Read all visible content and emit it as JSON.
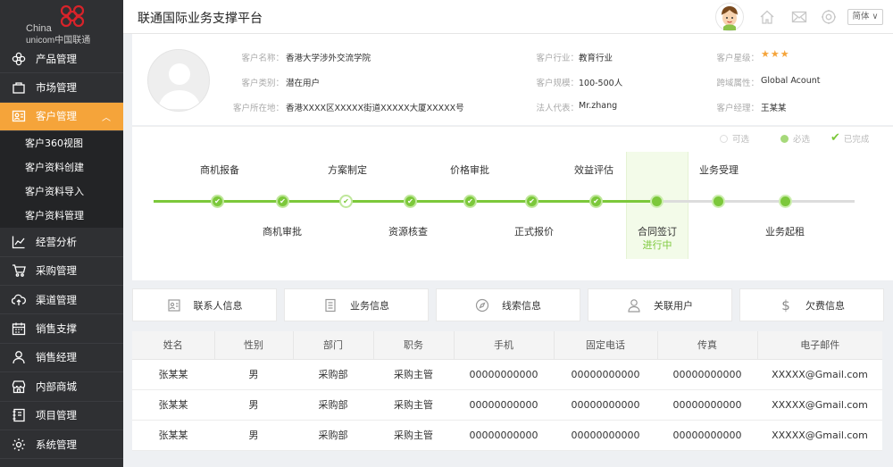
{
  "app": {
    "logo_china": "China",
    "logo_unicom": "unicom中国联通",
    "title": "联通国际业务支撑平台",
    "lang": "简体 ∨"
  },
  "sidebar": {
    "items": [
      {
        "label": "产品管理",
        "icon": "product-icon"
      },
      {
        "label": "市场管理",
        "icon": "market-icon"
      },
      {
        "label": "客户管理",
        "icon": "customer-icon",
        "active": true
      },
      {
        "label": "经营分析",
        "icon": "chart-icon"
      },
      {
        "label": "采购管理",
        "icon": "cart-icon"
      },
      {
        "label": "渠道管理",
        "icon": "cloud-icon"
      },
      {
        "label": "销售支撑",
        "icon": "calendar-icon"
      },
      {
        "label": "销售经理",
        "icon": "user-icon"
      },
      {
        "label": "内部商城",
        "icon": "shop-icon"
      },
      {
        "label": "项目管理",
        "icon": "book-icon"
      },
      {
        "label": "系统管理",
        "icon": "gear-icon"
      }
    ],
    "submenu": [
      "客户360视图",
      "客户资料创建",
      "客户资料导入",
      "客户资料管理"
    ]
  },
  "customer": {
    "name_label": "客户名称：",
    "name": "香港大学涉外交流学院",
    "type_label": "客户类别：",
    "type": "潜在用户",
    "location_label": "客户所在地：",
    "location": "香港XXXX区XXXXX街道XXXXX大厦XXXXX号",
    "industry_label": "客户行业：",
    "industry": "教育行业",
    "scale_label": "客户规模：",
    "scale": "100-500人",
    "legal_label": "法人代表：",
    "legal": "Mr.zhang",
    "rating_label": "客户星级：",
    "rating": 3,
    "cross_label": "跨域属性：",
    "cross": "Global Acount",
    "manager_label": "客户经理：",
    "manager": "王某某"
  },
  "legend": {
    "optional": "可选",
    "required": "必选",
    "done": "已完成"
  },
  "stages": {
    "top": [
      "商机报备",
      "方案制定",
      "价格审批",
      "效益评估",
      "业务受理"
    ],
    "bottom": [
      "商机审批",
      "资源核查",
      "正式报价",
      "合同签订",
      "业务起租"
    ],
    "current_status": "进行中"
  },
  "tabs": [
    "联系人信息",
    "业务信息",
    "线索信息",
    "关联用户",
    "欠费信息"
  ],
  "table": {
    "headers": [
      "姓名",
      "性别",
      "部门",
      "职务",
      "手机",
      "固定电话",
      "传真",
      "电子邮件"
    ],
    "rows": [
      [
        "张某某",
        "男",
        "采购部",
        "采购主管",
        "00000000000",
        "00000000000",
        "00000000000",
        "XXXXX@Gmail.com"
      ],
      [
        "张某某",
        "男",
        "采购部",
        "采购主管",
        "00000000000",
        "00000000000",
        "00000000000",
        "XXXXX@Gmail.com"
      ],
      [
        "张某某",
        "男",
        "采购部",
        "采购主管",
        "00000000000",
        "00000000000",
        "00000000000",
        "XXXXX@Gmail.com"
      ]
    ]
  },
  "colors": {
    "accent": "#f5a43a",
    "green": "#7cc83b",
    "sidebar": "#2f3033"
  }
}
